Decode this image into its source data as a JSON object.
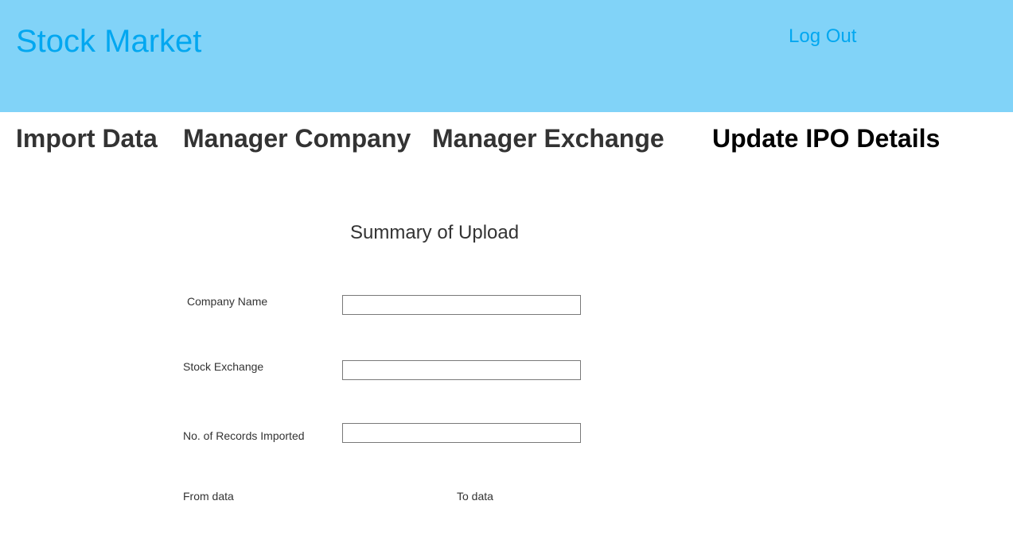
{
  "header": {
    "app_title": "Stock Market",
    "logout_label": "Log Out"
  },
  "nav": {
    "items": [
      {
        "label": "Import Data"
      },
      {
        "label": "Manager Company"
      },
      {
        "label": "Manager Exchange"
      },
      {
        "label": "Update IPO Details",
        "active": true
      }
    ]
  },
  "summary": {
    "title": "Summary of Upload",
    "fields": [
      {
        "label": "Company Name",
        "value": ""
      },
      {
        "label": "Stock Exchange",
        "value": ""
      },
      {
        "label": "No. of Records Imported",
        "value": ""
      }
    ],
    "from_label": "From data",
    "to_label": "To data"
  },
  "colors": {
    "header_bg": "#81d3f8",
    "accent": "#02a7f0",
    "nav_text": "#333333",
    "nav_active": "#000000",
    "field_border": "#797979"
  }
}
